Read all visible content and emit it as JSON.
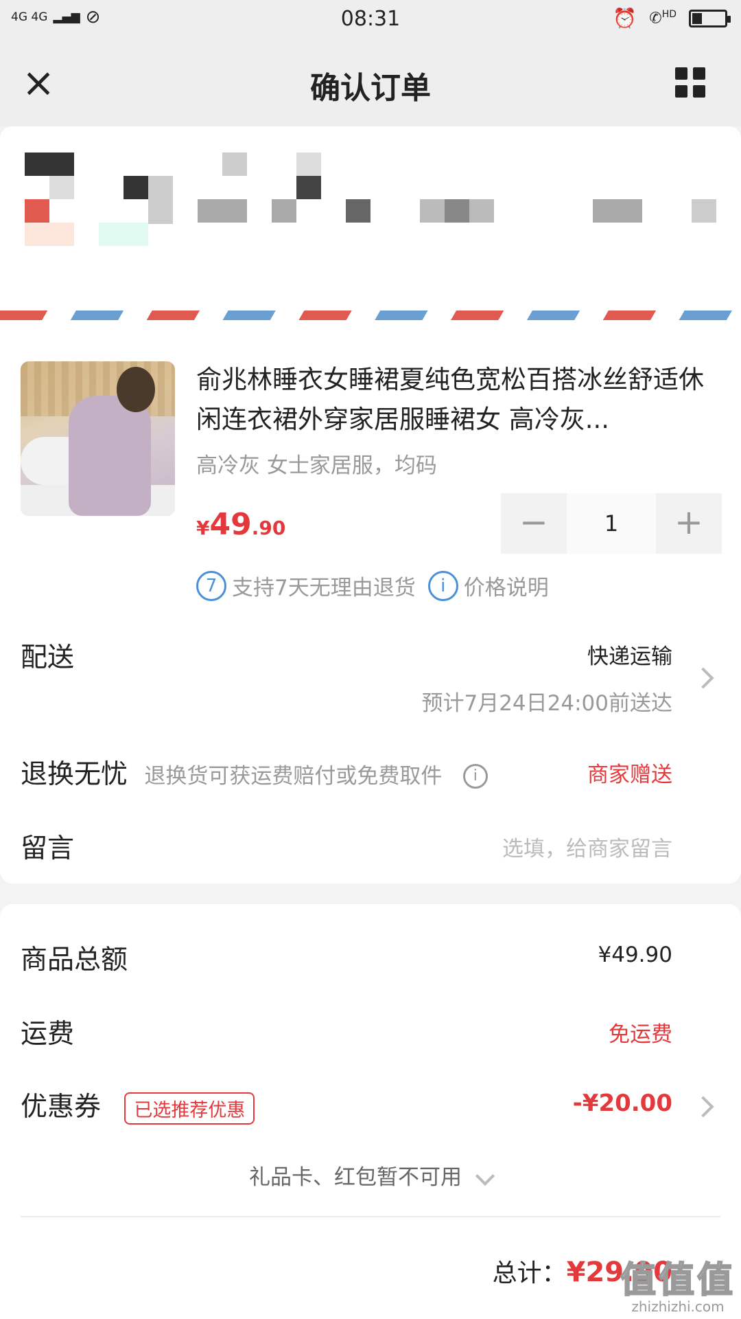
{
  "status_bar": {
    "network": "4G 4G",
    "time": "08:31",
    "hd_label": "HD",
    "battery_level": 0.3
  },
  "nav": {
    "title": "确认订单",
    "close_icon": "close-icon",
    "menu_icon": "grid-menu-icon"
  },
  "product": {
    "title": "俞兆林睡衣女睡裙夏纯色宽松百搭冰丝舒适休闲连衣裙外穿家居服睡裙女 高冷灰...",
    "spec": "高冷灰 女士家居服，均码",
    "price_currency": "¥",
    "price_integer": "49",
    "price_decimal": ".90",
    "quantity": "1",
    "minus": "−",
    "plus": "+",
    "return_badge": "7",
    "return_text": "支持7天无理由退货",
    "info_badge": "i",
    "price_note": "价格说明"
  },
  "delivery": {
    "label": "配送",
    "method": "快递运输",
    "eta": "预计7月24日24:00前送达"
  },
  "return_worry_free": {
    "label": "退换无忧",
    "desc": "退换货可获运费赔付或免费取件",
    "info_icon": "i",
    "value": "商家赠送"
  },
  "message": {
    "label": "留言",
    "placeholder": "选填，给商家留言"
  },
  "summary": {
    "goods_total_label": "商品总额",
    "goods_total": "¥49.90",
    "shipping_label": "运费",
    "shipping": "免运费",
    "coupon_label": "优惠券",
    "coupon_tag": "已选推荐优惠",
    "coupon_value": "-¥20.00",
    "gift_card_text": "礼品卡、红包暂不可用",
    "total_label": "总计：",
    "total_value": "¥29.90"
  },
  "watermark": {
    "logo": "值值值",
    "url": "zhizhizhi.com"
  },
  "colors": {
    "accent_red": "#e4393c",
    "info_blue": "#4a90d9",
    "airmail_red": "#e05a50",
    "airmail_blue": "#6a9fd4"
  }
}
